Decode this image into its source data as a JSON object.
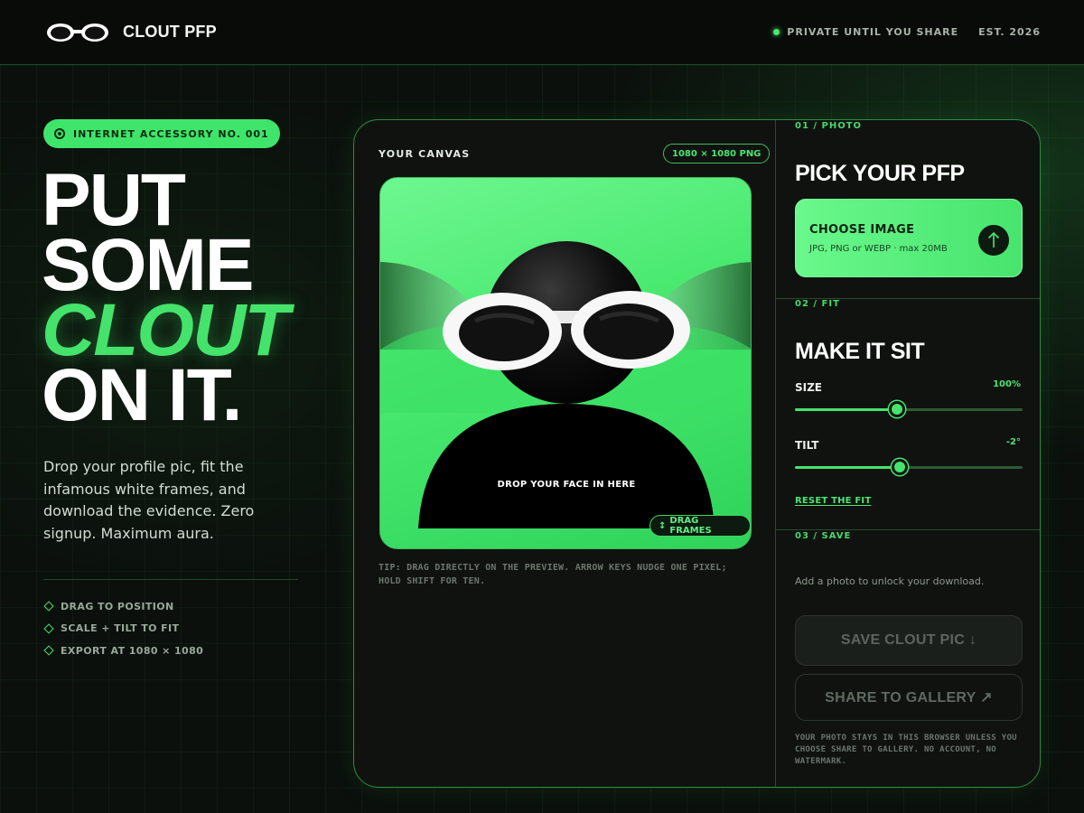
{
  "header": {
    "brand": "CLOUT PFP",
    "logo_icon": "sunglasses-icon",
    "status_text": "PRIVATE UNTIL YOU SHARE",
    "est_text": "EST. 2026"
  },
  "hero": {
    "pill": "INTERNET ACCESSORY NO. 001",
    "line1": "PUT",
    "line2": "SOME",
    "line3": "CLOUT",
    "line4": "ON IT.",
    "lead": "Drop your profile pic, fit the infamous white frames, and download the evidence. Zero signup. Maximum aura.",
    "features": [
      "DRAG TO POSITION",
      "SCALE + TILT TO FIT",
      "EXPORT AT 1080 × 1080"
    ]
  },
  "canvas": {
    "label": "YOUR CANVAS",
    "badge": "1080 × 1080 PNG",
    "drop_label": "DROP YOUR FACE IN HERE",
    "drag_button": "DRAG FRAMES",
    "tip": "TIP: DRAG DIRECTLY ON THE PREVIEW. ARROW KEYS NUDGE ONE PIXEL; HOLD SHIFT FOR TEN."
  },
  "photo": {
    "step": "01 / PHOTO",
    "title": "PICK YOUR PFP",
    "choose_title": "CHOOSE IMAGE",
    "choose_sub": "JPG, PNG or WEBP · max 20MB"
  },
  "fit": {
    "step": "02 / FIT",
    "title": "MAKE IT SIT",
    "size_label": "SIZE",
    "size_value": "100%",
    "size_level": 0.45,
    "tilt_label": "TILT",
    "tilt_value": "-2°",
    "tilt_level": 0.46,
    "reset": "RESET THE FIT"
  },
  "save": {
    "step": "03 / SAVE",
    "note": "Add a photo to unlock your download.",
    "save_button": "SAVE CLOUT PIC ↓",
    "share_button": "SHARE TO GALLERY ↗",
    "privacy": "YOUR PHOTO STAYS IN THIS BROWSER UNLESS YOU CHOOSE SHARE TO GALLERY. NO ACCOUNT, NO WATERMARK."
  },
  "colors": {
    "accent": "#45e36b",
    "background": "#0a0d0a",
    "card": "#101210"
  }
}
